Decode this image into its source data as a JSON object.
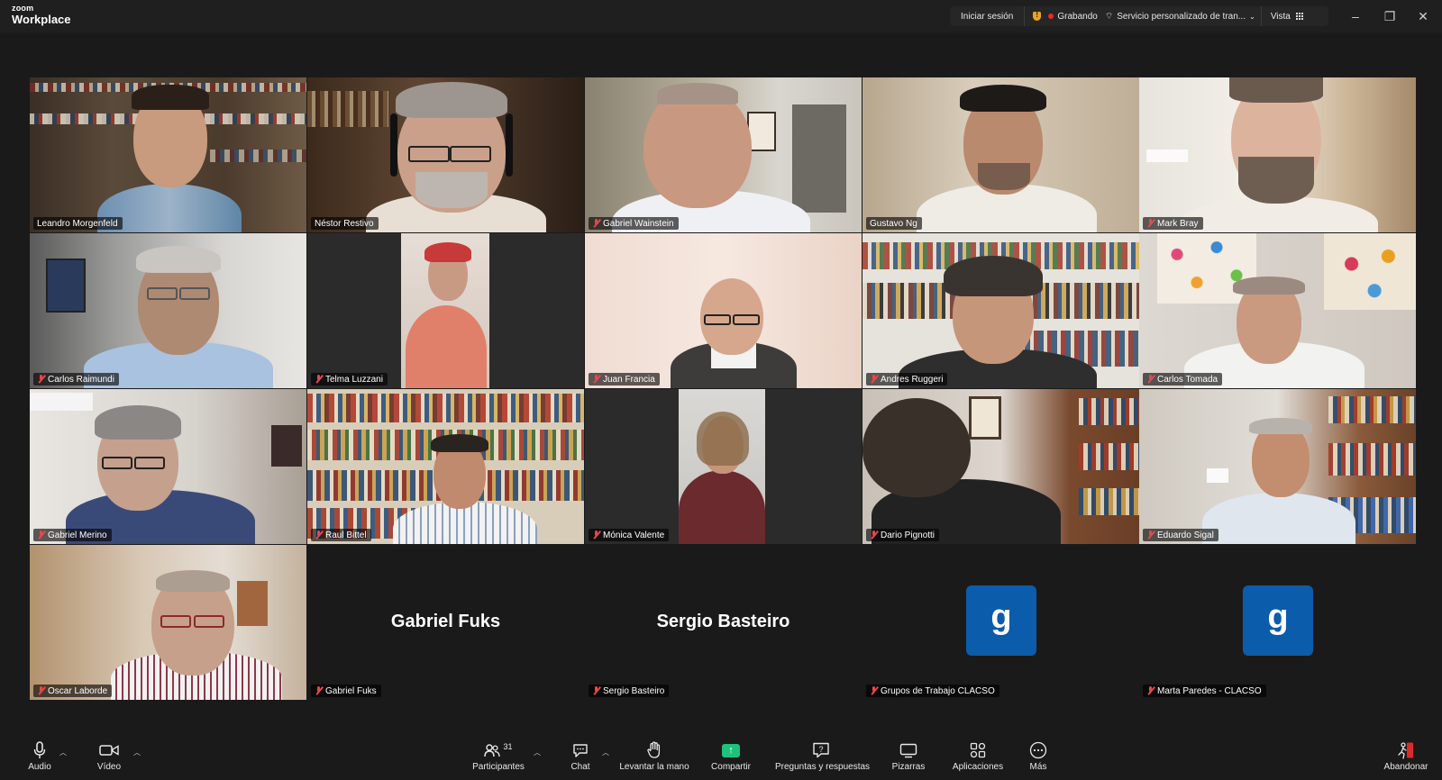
{
  "app": {
    "logo_top": "zoom",
    "logo_bottom": "Workplace"
  },
  "topbar": {
    "sign_in": "Iniciar sesión",
    "recording": "Grabando",
    "service": "Servicio personalizado de tran...",
    "view": "Vista"
  },
  "participants": [
    {
      "name": "Leandro Morgenfeld",
      "muted": false,
      "active": true
    },
    {
      "name": "Néstor Restivo",
      "muted": false
    },
    {
      "name": "Gabriel Wainstein",
      "muted": true
    },
    {
      "name": "Gustavo Ng",
      "muted": false
    },
    {
      "name": "Mark Bray",
      "muted": true
    },
    {
      "name": "Carlos Raimundi",
      "muted": true
    },
    {
      "name": "Telma Luzzani",
      "muted": true
    },
    {
      "name": "Juan Francia",
      "muted": true
    },
    {
      "name": "Andres Ruggeri",
      "muted": true
    },
    {
      "name": "Carlos Tomada",
      "muted": true
    },
    {
      "name": "Gabriel Merino",
      "muted": true
    },
    {
      "name": "Raul Bittel",
      "muted": true
    },
    {
      "name": "Mónica Valente",
      "muted": true
    },
    {
      "name": "Dario Pignotti",
      "muted": true
    },
    {
      "name": "Eduardo Sigal",
      "muted": true
    },
    {
      "name": "Oscar Laborde",
      "muted": true
    },
    {
      "name": "Gabriel Fuks",
      "muted": true,
      "video_off": true,
      "display": "Gabriel Fuks"
    },
    {
      "name": "Sergio Basteiro",
      "muted": true,
      "video_off": true,
      "display": "Sergio Basteiro"
    },
    {
      "name": "Grupos de Trabajo CLACSO",
      "muted": true,
      "video_off": true,
      "avatar_letter": "g"
    },
    {
      "name": "Marta Paredes - CLACSO",
      "muted": true,
      "video_off": true,
      "avatar_letter": "g"
    }
  ],
  "toolbar": {
    "audio": "Audio",
    "video": "Vídeo",
    "participants": "Participantes",
    "participants_count": "31",
    "chat": "Chat",
    "raise_hand": "Levantar la mano",
    "share": "Compartir",
    "qa": "Preguntas y respuestas",
    "whiteboards": "Pizarras",
    "apps": "Aplicaciones",
    "more": "Más",
    "leave": "Abandonar"
  },
  "colors": {
    "active_speaker": "#25c55c",
    "muted_icon": "#e5484d",
    "share": "#1ec27c",
    "avatar_bg": "#0b5cab",
    "recording": "#e02d2d"
  }
}
